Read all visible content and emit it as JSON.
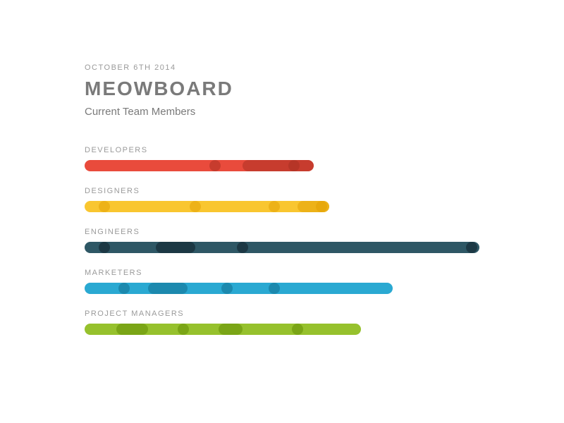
{
  "header": {
    "date": "OCTOBER 6TH 2014",
    "title": "MEOWBOARD",
    "subtitle": "Current Team Members"
  },
  "chart_data": {
    "type": "bar",
    "title": "Current Team Members",
    "max": 100,
    "series": [
      {
        "name": "DEVELOPERS",
        "value": 58,
        "color": "#e94b3c",
        "overlay_color": "#a62d1f",
        "markers": [
          {
            "type": "dot",
            "pos": 33
          },
          {
            "type": "pill",
            "pos": 40,
            "width": 18
          },
          {
            "type": "dot",
            "pos": 53
          }
        ]
      },
      {
        "name": "DESIGNERS",
        "value": 62,
        "color": "#f9c630",
        "overlay_color": "#e29d00",
        "markers": [
          {
            "type": "dot",
            "pos": 5
          },
          {
            "type": "dot",
            "pos": 28
          },
          {
            "type": "dot",
            "pos": 48
          },
          {
            "type": "pill",
            "pos": 54,
            "width": 8
          },
          {
            "type": "dot",
            "pos": 60
          }
        ]
      },
      {
        "name": "ENGINEERS",
        "value": 100,
        "color": "#2e5765",
        "overlay_color": "#0a1a24",
        "markers": [
          {
            "type": "dot",
            "pos": 5
          },
          {
            "type": "pill",
            "pos": 18,
            "width": 10
          },
          {
            "type": "dot",
            "pos": 40
          },
          {
            "type": "dot",
            "pos": 98
          }
        ]
      },
      {
        "name": "MARKETERS",
        "value": 78,
        "color": "#2aa9d2",
        "overlay_color": "#0e6a8a",
        "markers": [
          {
            "type": "dot",
            "pos": 10
          },
          {
            "type": "pill",
            "pos": 16,
            "width": 10
          },
          {
            "type": "dot",
            "pos": 36
          },
          {
            "type": "dot",
            "pos": 48
          }
        ]
      },
      {
        "name": "PROJECT MANAGERS",
        "value": 70,
        "color": "#96c12d",
        "overlay_color": "#5d8a00",
        "markers": [
          {
            "type": "pill",
            "pos": 8,
            "width": 8
          },
          {
            "type": "dot",
            "pos": 25
          },
          {
            "type": "pill",
            "pos": 34,
            "width": 6
          },
          {
            "type": "dot",
            "pos": 54
          }
        ]
      }
    ]
  }
}
